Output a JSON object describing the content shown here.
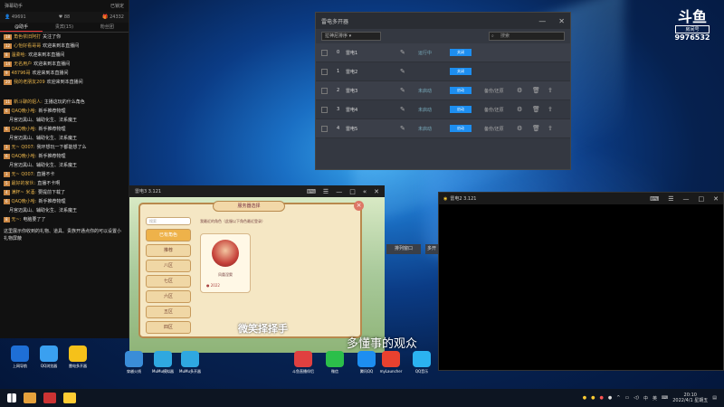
{
  "chat": {
    "title": "弹幕助手",
    "status": "已锁定",
    "viewers": "49691",
    "fans": "88",
    "gifts": "24332",
    "tabs": [
      "@助手",
      "贵宾(15)",
      "粉丝团"
    ],
    "messages": [
      {
        "lv": "18",
        "name": "角色依旧阿打",
        "text": "关注了你"
      },
      {
        "lv": "12",
        "name": "心怡好看哥哥",
        "text": "欢迎来到本直播间"
      },
      {
        "lv": "8",
        "name": "温柔哈:",
        "text": "欢迎来到本直播间"
      },
      {
        "lv": "14",
        "name": "无名用户",
        "text": "欢迎来到本直播间"
      },
      {
        "lv": "9",
        "name": "48796哥",
        "text": "欢迎来到本直播间"
      },
      {
        "lv": "20",
        "name": "我的老朋友209",
        "text": "欢迎来到本直播间"
      },
      {
        "lv": "11",
        "name": "新斗聊的姐人:",
        "text": "主播这玩的什么角色"
      },
      {
        "lv": "6",
        "name": "QAQ晚小哈:",
        "text": "新手推荐物理"
      },
      {
        "lv": "",
        "name": "",
        "text": "月宫迈黑山、辅助化生、法系魔王"
      },
      {
        "lv": "6",
        "name": "QAQ晚小哈:",
        "text": "新手推荐物理"
      },
      {
        "lv": "",
        "name": "",
        "text": "月宫迈黑山、辅助化生、法系魔王"
      },
      {
        "lv": "3",
        "name": "无~ Q007:",
        "text": "我环想玩一下都能想了么"
      },
      {
        "lv": "6",
        "name": "QAQ晚小哈:",
        "text": "新手推荐物理"
      },
      {
        "lv": "",
        "name": "",
        "text": "月宫迈黑山、辅助化生、法系魔王"
      },
      {
        "lv": "3",
        "name": "无~ Q007:",
        "text": "直播不卡"
      },
      {
        "lv": "5",
        "name": "最好的家伙:",
        "text": "直播不卡啊"
      },
      {
        "lv": "4",
        "name": "满杯~ 米酒:",
        "text": "要提前下载了"
      },
      {
        "lv": "6",
        "name": "QAQ晚小哈:",
        "text": "新手推荐物理"
      },
      {
        "lv": "",
        "name": "",
        "text": "月宫迈黑山、辅助化生、法系魔王"
      },
      {
        "lv": "8",
        "name": "无~:",
        "text": "电脑要了了"
      }
    ],
    "footer_note": "这里展示你收到的礼物、道具、贵族开通点你的可以设置小礼物屏蔽"
  },
  "multi_opener": {
    "title": "雷电多开器",
    "sort_label": "拉神尼排序",
    "search_placeholder": "搜索",
    "rows": [
      {
        "id": "0",
        "name": "雷电1",
        "status": "运行中",
        "button": "关闭",
        "backup": ""
      },
      {
        "id": "1",
        "name": "雷电2",
        "status": "",
        "button": "关闭",
        "backup": ""
      },
      {
        "id": "2",
        "name": "雷电3",
        "status": "未启动",
        "button": "启动",
        "backup": "备份/还原"
      },
      {
        "id": "3",
        "name": "雷电4",
        "status": "未启动",
        "button": "启动",
        "backup": "备份/还原"
      },
      {
        "id": "4",
        "name": "雷电5",
        "status": "未启动",
        "button": "启动",
        "backup": "备份/还原"
      }
    ],
    "sort_window": "排列窗口",
    "partial": "多开"
  },
  "game": {
    "title": "雷电3 3.121",
    "panel_title": "服务器选择",
    "search": "搜索",
    "recent": "我最近的角色（此服以下角色最近登录）",
    "zones": [
      "已有角色",
      "推荐",
      "八区",
      "七区",
      "六区",
      "五区",
      "四区"
    ],
    "char_name": "凤凰涅槃",
    "char_server": "2022",
    "overlay_text": "微笑择择手"
  },
  "subtitle": "多懂事的观众",
  "black_window": {
    "title": "雷电2 3.121"
  },
  "logo": {
    "brand": "斗鱼",
    "sub": "房间号",
    "room": "9976532"
  },
  "desktop_icons": [
    "上网导航",
    "QQ浏览器",
    "雷电多开器",
    "穿越火线",
    "MuMu模拟器",
    "MuMu多开器",
    "斗鱼直播伴侣",
    "微信",
    "腾讯QQ",
    "myLauncher",
    "QQ音乐"
  ],
  "taskbar": {
    "lang": "中",
    "ime": "英",
    "time": "20:10",
    "date": "2022/4/1 星期五"
  }
}
